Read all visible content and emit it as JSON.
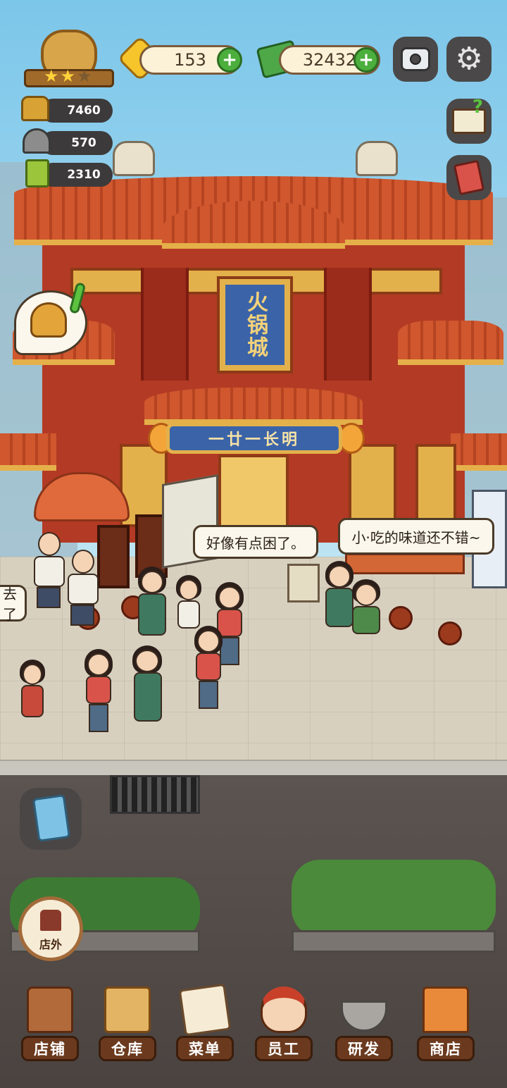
{
  "hud": {
    "stars_filled": 2,
    "stars_total": 3,
    "gems": "153",
    "cash": "32432",
    "stats": [
      {
        "icon": "gold-ingot-icon",
        "value": "7460"
      },
      {
        "icon": "food-cloche-icon",
        "value": "570"
      },
      {
        "icon": "recipe-book-icon",
        "value": "2310"
      }
    ]
  },
  "restaurant": {
    "main_sign": "火锅城",
    "sub_sign": "一廿一长明"
  },
  "bubbles": {
    "left_partial": "去了",
    "center": "好像有点困了。",
    "right": "小·吃的味道还不错~"
  },
  "scene_button": {
    "label": "店外"
  },
  "nav": [
    {
      "label": "店铺",
      "icon": "shop-building-icon"
    },
    {
      "label": "仓库",
      "icon": "warehouse-boxes-icon"
    },
    {
      "label": "菜单",
      "icon": "menu-clipboard-icon"
    },
    {
      "label": "员工",
      "icon": "staff-chef-icon"
    },
    {
      "label": "研发",
      "icon": "research-wok-icon"
    },
    {
      "label": "商店",
      "icon": "store-stall-icon"
    }
  ],
  "colors": {
    "accent_green": "#4caf3d",
    "roof_orange": "#d0572e",
    "sign_blue": "#3b63a8",
    "gold": "#e3b14b"
  }
}
